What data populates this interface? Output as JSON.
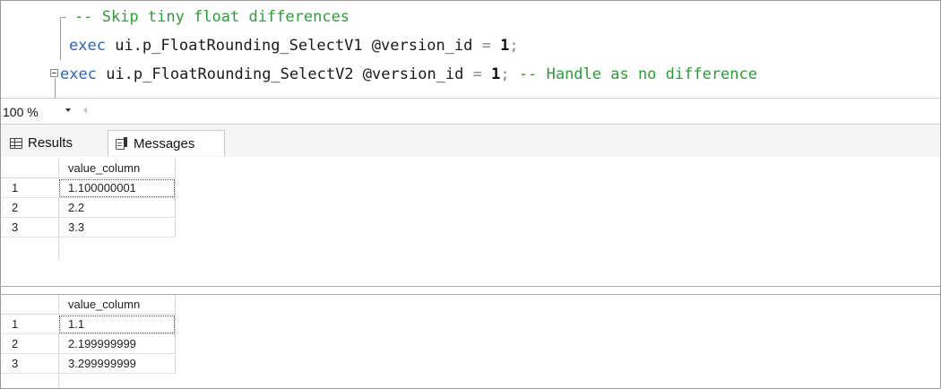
{
  "editor": {
    "line1": {
      "comment": "-- Skip tiny float differences"
    },
    "line2": {
      "kw": "exec",
      "proc": "ui.p_FloatRounding_SelectV1",
      "param": "@version_id",
      "op": "=",
      "value": "1",
      "end": ";"
    },
    "line3": {
      "kw": "exec",
      "proc": "ui.p_FloatRounding_SelectV2",
      "param": "@version_id",
      "op": "=",
      "value": "1",
      "end": ";",
      "comment": "-- Handle as no difference"
    }
  },
  "zoom": {
    "value": "100 %"
  },
  "tabs": {
    "results": "Results",
    "messages": "Messages"
  },
  "grids": [
    {
      "column": "value_column",
      "rows": [
        {
          "num": "1",
          "value": "1.100000001"
        },
        {
          "num": "2",
          "value": "2.2"
        },
        {
          "num": "3",
          "value": "3.3"
        }
      ]
    },
    {
      "column": "value_column",
      "rows": [
        {
          "num": "1",
          "value": "1.1"
        },
        {
          "num": "2",
          "value": "2.199999999"
        },
        {
          "num": "3",
          "value": "3.299999999"
        }
      ]
    }
  ],
  "colors": {
    "keyword": "#2b63b8",
    "comment": "#2e9c3a",
    "operator": "#8a8a8a"
  },
  "icons": {
    "results_tab": "grid-icon",
    "messages_tab": "messages-icon",
    "zoom_dropdown": "chevron-down-icon",
    "fold": "collapse-icon"
  }
}
